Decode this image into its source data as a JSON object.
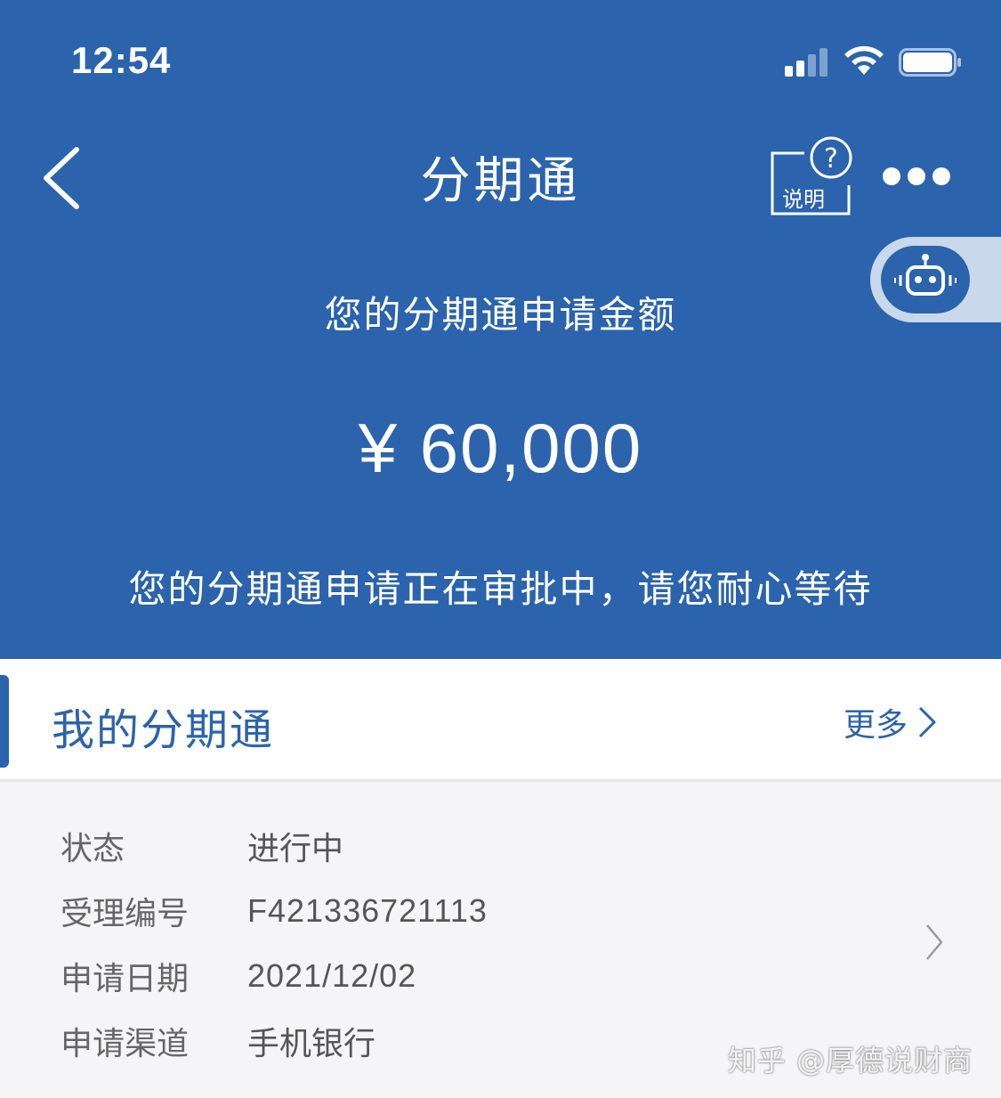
{
  "status_bar": {
    "time": "12:54"
  },
  "nav": {
    "title": "分期通",
    "explain_label": "说明"
  },
  "hero": {
    "apply_label": "您的分期通申请金额",
    "amount": "¥ 60,000",
    "status_message": "您的分期通申请正在审批中，请您耐心等待"
  },
  "section": {
    "title": "我的分期通",
    "more_label": "更多"
  },
  "record": {
    "rows": [
      {
        "label": "状态",
        "value": "进行中"
      },
      {
        "label": "受理编号",
        "value": "F421336721113"
      },
      {
        "label": "申请日期",
        "value": "2021/12/02"
      },
      {
        "label": "申请渠道",
        "value": "手机银行"
      }
    ]
  },
  "watermark": "知乎 @厚德说财商",
  "colors": {
    "brand_blue": "#2b63ad",
    "background": "#f5f5f7"
  }
}
